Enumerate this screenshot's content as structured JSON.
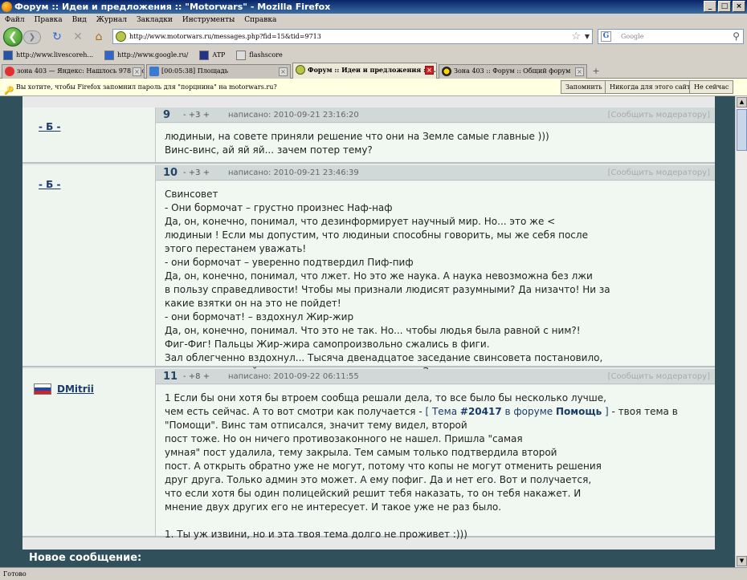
{
  "window": {
    "title": "Форум :: Идеи и предложения :: \"Motorwars\" - Mozilla Firefox"
  },
  "menu": [
    "Файл",
    "Правка",
    "Вид",
    "Журнал",
    "Закладки",
    "Инструменты",
    "Справка"
  ],
  "nav": {
    "url": "http://www.motorwars.ru/messages.php?fid=15&tid=9713",
    "search_placeholder": "Google"
  },
  "bookmarks": [
    {
      "label": "http://www.livescoreh...",
      "color": "#2255aa"
    },
    {
      "label": "http://www.google.ru/",
      "color": "#3366cc"
    },
    {
      "label": "ATP",
      "color": "#223388"
    },
    {
      "label": "flashscore",
      "color": "#dddddd"
    }
  ],
  "tabs": [
    {
      "label": "зона 403 — Яндекс: Нашлось 978 тыс. ..."
    },
    {
      "label": "[00:05:38] Площадь"
    },
    {
      "label": "Форум :: Идеи и предложения :: \"...\""
    },
    {
      "label": "Зона 403 :: Форум :: Общий форум"
    }
  ],
  "notification": {
    "text": "Вы хотите, чтобы Firefox запомнил пароль для \"порцнина\" на motorwars.ru?",
    "remember": "Запомнить",
    "never": "Никогда для этого сайта",
    "not_now": "Не сейчас"
  },
  "posts": [
    {
      "num": "9",
      "rating": "- +3 +",
      "date": "написано: 2010-09-21 23:16:20",
      "report": "[Сообщить модератору]",
      "author": "- Б -",
      "body": "людиныи, на совете приняли решение что они на Земле самые главные )))\nВинс-винс, ай яй яй... зачем потер тему?"
    },
    {
      "num": "10",
      "rating": "- +3 +",
      "date": "написано: 2010-09-21 23:46:39",
      "report": "[Сообщить модератору]",
      "author": "- Б -",
      "body": "Свинсовет\n- Они бормочат – грустно произнес Наф-наф\nДа, он, конечно, понимал, что дезинформирует научный мир. Но... это же <\nлюдиныи ! Если мы допустим, что людиныи способны говорить, мы же себя после\nэтого перестанем уважать!\n- они бормочат – уверенно подтвердил Пиф-пиф\nДа, он, конечно, понимал, что лжет. Но это же наука. А наука невозможна без лжи\nв пользу справедливости! Чтобы мы признали людисят разумными? Да низачто! Ни за\nкакие взятки он на это не пойдет!\n- они бормочат! – вздохнул Жир-жир\nДа, он, конечно, понимал. Что это не так. Но... чтобы людья была равной с ним?!\nФиг-Фиг! Пальцы Жир-жира самопроизвольно сжались в фиги.\nЗал облегченно вздохнул... Тысяча двенадцатое заседание свинсовета постановило,\nчто, кроме свиней, разумных существ на планете Земля нет..."
    },
    {
      "num": "11",
      "rating": "- +8 +",
      "date": "написано: 2010-09-22 06:11:55",
      "report": "[Сообщить модератору]",
      "author": "DMitrii",
      "body_before": "1 Если бы они хотя бы втроем сообща решали дела, то все было бы несколько лучше,\nчем есть сейчас. А то вот смотри как получается - ",
      "link_open": "[ Тема ",
      "link_topic": "#20417",
      "link_mid": " в форуме ",
      "link_forum": "Помощь",
      "link_close": " ]",
      "body_after": " - твоя тема в\n\"Помощи\". Винс там отписался, значит тему видел, второй\nпост тоже. Но он ничего противозаконного не нашел. Пришла \"самая\nумная\" пост удалила, тему закрыла. Тем самым только подтвердила второй\nпост. А открыть обратно уже не могут, потому что копы не могут отменить решения\nдруг друга. Только админ это может. А ему пофиг. Да и нет его. Вот и получается,\nчто если хотя бы один полицейский решит тебя наказать, то он тебя накажет. И\nмнение двух других его не интересует. И такое уже не раз было.\n\n1. Ты уж извини, но и эта твоя тема долго не проживет :)))"
    }
  ],
  "new_message": "Новое сообщение:",
  "status": "Готово"
}
